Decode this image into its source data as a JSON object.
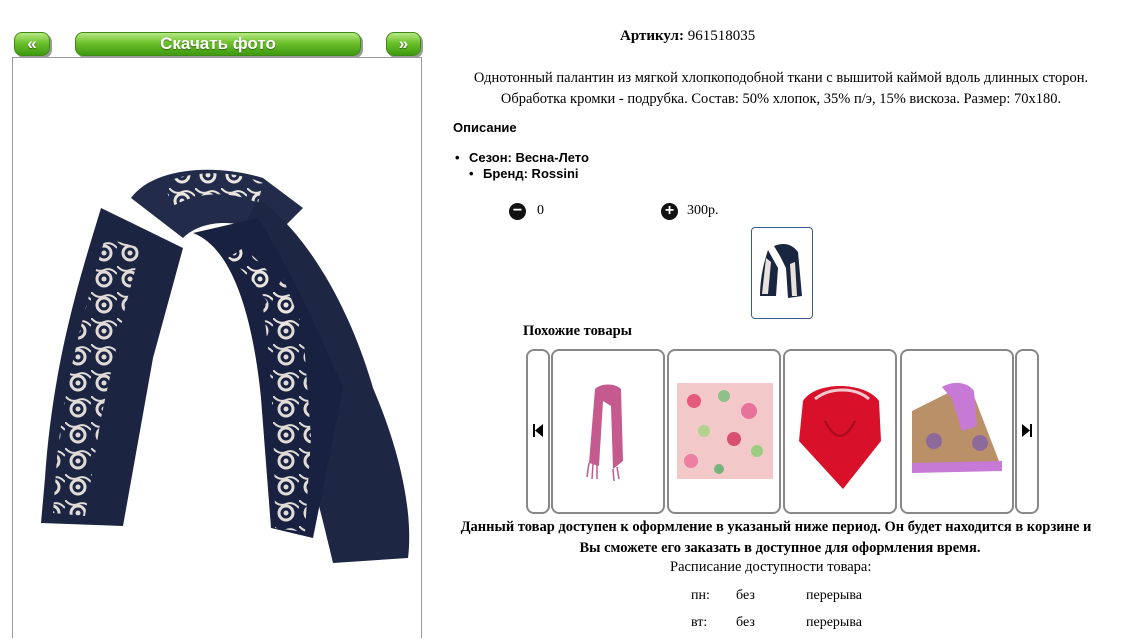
{
  "nav": {
    "prev_label": "«",
    "download_label": "Скачать фото",
    "next_label": "»"
  },
  "product": {
    "article_label": "Артикул:",
    "article_value": "961518035",
    "description_line1": "Однотонный палантин из мягкой хлопкоподобной ткани с вышитой каймой вдоль длинных сторон.",
    "description_line2": "Обработка кромки - подрубка. Состав: 50% хлопок, 35% п/э, 15% вискоза. Размер: 70х180.",
    "description_heading": "Описание",
    "props": [
      "Сезон: Весна-Лето",
      "Бренд: Rossini"
    ],
    "quantity": "0",
    "price": "300р.",
    "colors": {
      "navy": "#1a2540",
      "lace": "#e8e2dc"
    }
  },
  "similar": {
    "title": "Похожие товары",
    "items": [
      {
        "icon": "pink-scarf"
      },
      {
        "icon": "floral-square-scarf"
      },
      {
        "icon": "red-square-scarf"
      },
      {
        "icon": "lilac-paisley-scarf"
      }
    ]
  },
  "availability": {
    "line1": "Данный товар доступен к оформление в указаный ниже период. Он будет находится в корзине и",
    "line2": "Вы сможете его заказать в доступное для оформления время.",
    "schedule_title": "Расписание доступности товара:",
    "rows": [
      {
        "day": "пн:",
        "from": "без",
        "to": "перерыва"
      },
      {
        "day": "вт:",
        "from": "без",
        "to": "перерыва"
      }
    ]
  }
}
